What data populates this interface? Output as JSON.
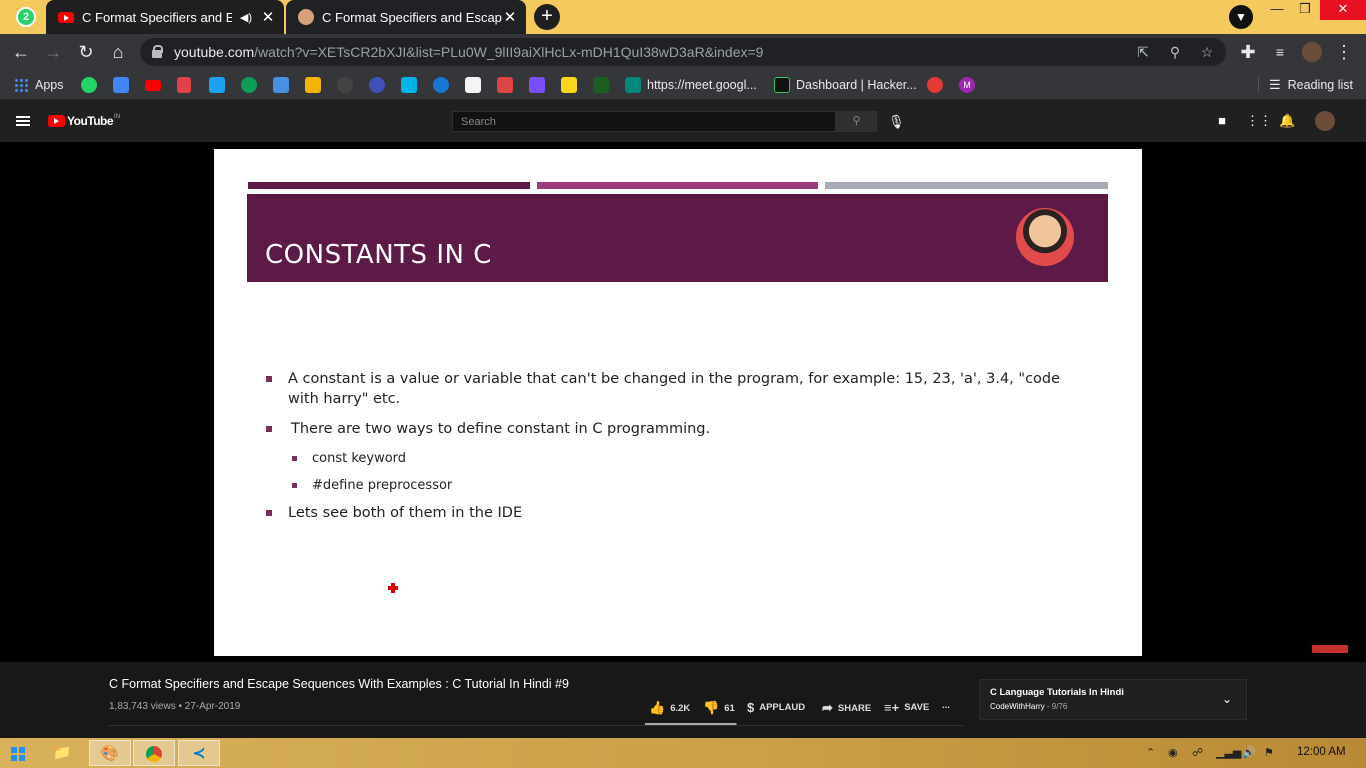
{
  "browser": {
    "ext_badge": "2",
    "tabs": [
      {
        "title": "C Format Specifiers and Esca",
        "audio_icon": "speaker-icon"
      },
      {
        "title": "C Format Specifiers and Escape S"
      }
    ],
    "new_tab": "+",
    "url_host": "youtube.com",
    "url_path": "/watch?v=XETsCR2bXJI&list=PLu0W_9lII9aiXlHcLx-mDH1QuI38wD3aR&index=9",
    "bookmarks": {
      "apps_label": "Apps",
      "meet_label": "https://meet.googl...",
      "hacker_label": "Dashboard | Hacker...",
      "m_badge": "M",
      "reading_list_label": "Reading list"
    }
  },
  "youtube": {
    "logo_word": "YouTube",
    "logo_region": "IN",
    "search_placeholder": "Search"
  },
  "slide": {
    "title": "CONSTANTS IN C",
    "bullets": [
      "A constant is a value or variable that can't be changed in the program, for example: 15, 23, 'a', 3.4, \"code with harry\" etc.",
      "There are two ways to define constant in C programming.",
      "const keyword",
      "#define preprocessor",
      "Lets see both of them in the IDE"
    ],
    "colors": {
      "banner": "#5e1a47",
      "stripe1": "#5e1a47",
      "stripe2": "#9b3a7c",
      "stripe3": "#a7a9b4"
    }
  },
  "video": {
    "title": "C Format Specifiers and Escape Sequences With Examples : C Tutorial In Hindi #9",
    "meta": "1,83,743 views • 27-Apr-2019",
    "likes": "6.2K",
    "dislikes": "61",
    "applaud": "APPLAUD",
    "share": "SHARE",
    "save": "SAVE",
    "more": "...",
    "like_ratio": 0.99
  },
  "playlist": {
    "title": "C Language Tutorials In Hindi",
    "channel": "CodeWithHarry",
    "position": " - 9/76"
  },
  "taskbar": {
    "clock": "12:00 AM"
  }
}
